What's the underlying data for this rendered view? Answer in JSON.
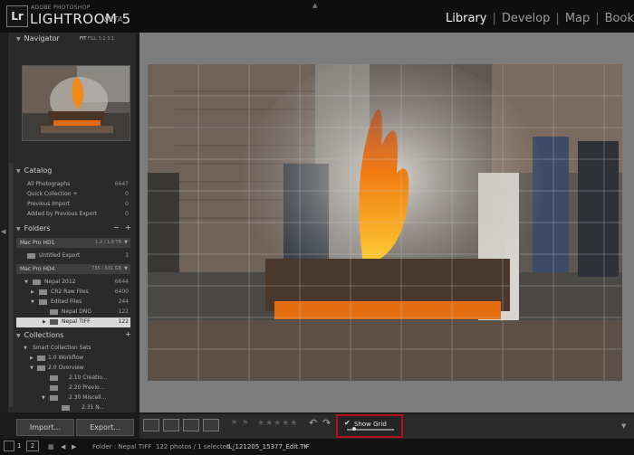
{
  "app": {
    "logo": "Lr",
    "vendor": "ADOBE PHOTOSHOP",
    "name": "LIGHTROOM 5",
    "edition": "BETA"
  },
  "modules": [
    {
      "label": "Library",
      "active": true
    },
    {
      "label": "Develop",
      "active": false
    },
    {
      "label": "Map",
      "active": false
    },
    {
      "label": "Book",
      "active": false
    }
  ],
  "navigator": {
    "title": "Navigator",
    "zoom_options": [
      "FIT",
      "FILL",
      "1:1",
      "3:1"
    ]
  },
  "catalog": {
    "title": "Catalog",
    "items": [
      {
        "label": "All Photographs",
        "count": "6647"
      },
      {
        "label": "Quick Collection +",
        "count": "0"
      },
      {
        "label": "Previous Import",
        "count": "0"
      },
      {
        "label": "Added by Previous Export",
        "count": "0"
      }
    ]
  },
  "folders": {
    "title": "Folders",
    "add": "+",
    "remove": "−",
    "volumes": [
      {
        "name": "Mac Pro HD1",
        "space": "1.2 / 1.8 TB"
      },
      {
        "name": "Mac Pro HD4",
        "space": "735 / 931 GB"
      }
    ],
    "items": [
      {
        "label": "Untitled Export",
        "count": "3"
      },
      {
        "label": "Nepal 2012",
        "count": "6644"
      },
      {
        "label": "CR2 Raw Files",
        "count": "6400"
      },
      {
        "label": "Edited Files",
        "count": "244"
      },
      {
        "label": "Nepal DNG",
        "count": "122"
      },
      {
        "label": "Nepal TIFF",
        "count": "122"
      }
    ]
  },
  "collections": {
    "title": "Collections",
    "add": "+",
    "items": [
      {
        "label": "Smart Collection Sets"
      },
      {
        "label": "1.0 Workflow"
      },
      {
        "label": "2.0 Overview"
      },
      {
        "label": "2.10 Creatio..."
      },
      {
        "label": "2.20 Previo..."
      },
      {
        "label": "2.30 Miscell..."
      },
      {
        "label": "2.31 N..."
      }
    ]
  },
  "buttons": {
    "import": "Import...",
    "export": "Export..."
  },
  "toolbar": {
    "show_grid_label": "Show Grid",
    "show_grid_checked": true,
    "stars": "★★★★★"
  },
  "filmstrip": {
    "page1": "1",
    "page2": "2",
    "source": "Folder : Nepal TIFF",
    "status": "122 photos / 1 selected /",
    "filename": "IL_121205_15377_Edit.TIF"
  },
  "colors": {
    "accent_highlight": "#b3121a",
    "active_module": "#f2f2f2"
  }
}
